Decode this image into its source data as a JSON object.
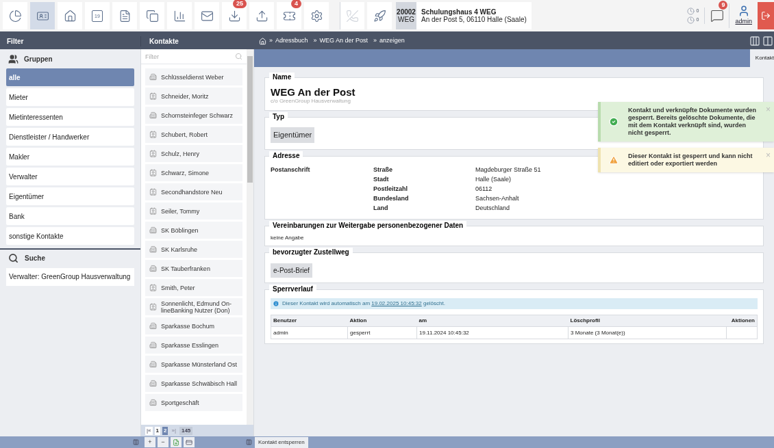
{
  "toolbar": [
    {
      "selected": false,
      "disabled": false
    },
    {
      "selected": true,
      "disabled": false
    },
    {
      "selected": false,
      "disabled": false
    },
    {
      "selected": false,
      "disabled": false,
      "label": "19"
    },
    {
      "selected": false,
      "disabled": false
    },
    {
      "selected": false,
      "disabled": false
    },
    {
      "selected": false,
      "disabled": false
    },
    {
      "selected": false,
      "disabled": false
    },
    {
      "selected": false,
      "disabled": false,
      "badge": "25"
    },
    {
      "selected": false,
      "disabled": false
    },
    {
      "selected": false,
      "disabled": false,
      "badge": "4"
    },
    {
      "selected": false,
      "disabled": false
    },
    {
      "selected": false,
      "disabled": true
    },
    {
      "selected": false,
      "disabled": false
    }
  ],
  "property": {
    "number": "20002",
    "type": "WEG",
    "name": "Schulungshaus 4 WEG",
    "address": "An der Post 5, 06110 Halle (Saale)"
  },
  "status": {
    "counters": [
      "0",
      "0"
    ],
    "messages_badge": "9",
    "user": "admin"
  },
  "columns": {
    "filter": "Filter",
    "contacts": "Kontakte"
  },
  "breadcrumb": {
    "separator": "»",
    "items": [
      "Adressbuch",
      "WEG An der Post",
      "anzeigen"
    ]
  },
  "groups": {
    "title": "Gruppen",
    "items": [
      {
        "label": "alle",
        "selected": true
      },
      {
        "label": "Mieter",
        "selected": false
      },
      {
        "label": "Mietinteressenten",
        "selected": false
      },
      {
        "label": "Dienstleister / Handwerker",
        "selected": false
      },
      {
        "label": "Makler",
        "selected": false
      },
      {
        "label": "Verwalter",
        "selected": false
      },
      {
        "label": "Eigentümer",
        "selected": false
      },
      {
        "label": "Bank",
        "selected": false
      },
      {
        "label": "sonstige Kontakte",
        "selected": false
      }
    ]
  },
  "search": {
    "title": "Suche",
    "items": [
      "Verwalter: GreenGroup Hausverwaltung"
    ]
  },
  "contacts": {
    "placeholder": "Filter",
    "items": [
      {
        "name": "Schlüsseldienst Weber",
        "kind": "company"
      },
      {
        "name": "Schneider, Moritz",
        "kind": "person"
      },
      {
        "name": "Schornsteinfeger Schwarz",
        "kind": "company"
      },
      {
        "name": "Schubert, Robert",
        "kind": "person"
      },
      {
        "name": "Schulz, Henry",
        "kind": "person"
      },
      {
        "name": "Schwarz, Simone",
        "kind": "person"
      },
      {
        "name": "Secondhandstore Neu",
        "kind": "person"
      },
      {
        "name": "Seiler, Tommy",
        "kind": "person"
      },
      {
        "name": "SK Böblingen",
        "kind": "company"
      },
      {
        "name": "SK Karlsruhe",
        "kind": "company"
      },
      {
        "name": "SK Tauberfranken",
        "kind": "company"
      },
      {
        "name": "Smith, Peter",
        "kind": "person"
      },
      {
        "name": "Sonnenlicht, Edmund On-lineBanking Nutzer (Don)",
        "kind": "person"
      },
      {
        "name": "Sparkasse Bochum",
        "kind": "company"
      },
      {
        "name": "Sparkasse Esslingen",
        "kind": "company"
      },
      {
        "name": "Sparkasse Münsterland Ost",
        "kind": "company"
      },
      {
        "name": "Sparkasse Schwäbisch Hall",
        "kind": "company"
      },
      {
        "name": "Sportgeschäft",
        "kind": "company"
      }
    ],
    "pager": {
      "first": "|«",
      "pages": [
        {
          "label": "1",
          "selected": false
        },
        {
          "label": "2",
          "selected": true
        }
      ],
      "last": "»|",
      "total": "145"
    },
    "actions": [
      "+",
      "−"
    ]
  },
  "tab": {
    "label": "Kontakt"
  },
  "detail": {
    "name": {
      "legend": "Name",
      "title": "WEG An der Post",
      "subtitle": "c/o GreenGroup Hausverwaltung"
    },
    "type": {
      "legend": "Typ",
      "tag": "Eigentümer"
    },
    "address": {
      "legend": "Adresse",
      "label": "Postanschrift",
      "rows": [
        {
          "key": "Straße",
          "value": "Magdeburger Straße 51"
        },
        {
          "key": "Stadt",
          "value": "Halle (Saale)"
        },
        {
          "key": "Postleitzahl",
          "value": "06112"
        },
        {
          "key": "Bundesland",
          "value": "Sachsen-Anhalt"
        },
        {
          "key": "Land",
          "value": "Deutschland"
        }
      ]
    },
    "agreements": {
      "legend": "Vereinbarungen zur Weitergabe personenbezogener Daten",
      "text": "keine Angabe"
    },
    "delivery": {
      "legend": "bevorzugter Zustellweg",
      "tag": "e-Post-Brief"
    },
    "lock_history": {
      "legend": "Sperrverlauf",
      "info_before": "Dieser Kontakt wird automatisch am",
      "info_date": "19.02.2025 10:45:32",
      "info_after": "gelöscht.",
      "columns": [
        "Benutzer",
        "Aktion",
        "am",
        "Löschprofil",
        "Aktionen"
      ],
      "rows": [
        [
          "admin",
          "gesperrt",
          "19.11.2024 10:45:32",
          "3 Monate (3 Monat(e))",
          ""
        ]
      ]
    }
  },
  "toasts": [
    {
      "kind": "success",
      "text": "Kontakt und verknüpfte Dokumente wurden gesperrt. Bereits gelöschte Dokumente, die mit dem Kontakt verknüpft sind, wurden nicht gesperrt.",
      "close": "×"
    },
    {
      "kind": "warning",
      "text": "Dieser Kontakt ist gesperrt und kann nicht editiert oder exportiert werden",
      "close": "×"
    }
  ],
  "footer": {
    "button": "Kontakt entsperren"
  }
}
